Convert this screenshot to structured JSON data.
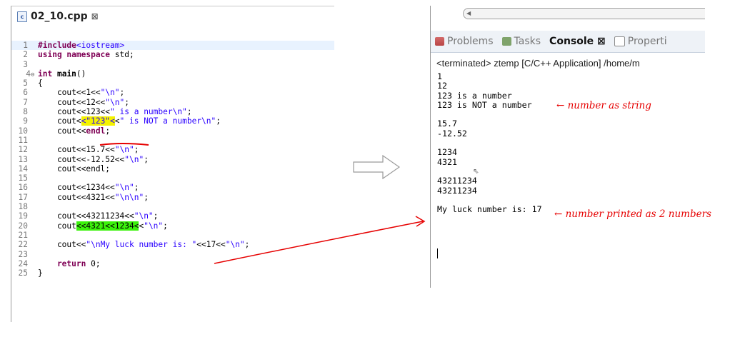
{
  "editor": {
    "tab_icon": "c",
    "tab_title": "02_10.cpp",
    "tab_close": "⊠",
    "fold_marker": "⊖",
    "lines": [
      {
        "n": "1"
      },
      {
        "n": "2"
      },
      {
        "n": "3"
      },
      {
        "n": "4"
      },
      {
        "n": "5"
      },
      {
        "n": "6"
      },
      {
        "n": "7"
      },
      {
        "n": "8"
      },
      {
        "n": "9"
      },
      {
        "n": "10"
      },
      {
        "n": "11"
      },
      {
        "n": "12"
      },
      {
        "n": "13"
      },
      {
        "n": "14"
      },
      {
        "n": "15"
      },
      {
        "n": "16"
      },
      {
        "n": "17"
      },
      {
        "n": "18"
      },
      {
        "n": "19"
      },
      {
        "n": "20"
      },
      {
        "n": "21"
      },
      {
        "n": "22"
      },
      {
        "n": "23"
      },
      {
        "n": "24"
      },
      {
        "n": "25"
      }
    ],
    "code": {
      "l1_kw": "#include",
      "l1_str": "<iostream>",
      "l2_kw": "using namespace",
      "l2_rest": " std;",
      "l4_kw": "int",
      "l4_fn": "main",
      "l4_rest": "()",
      "l5": "{",
      "l6_a": "    cout<<1<<",
      "l6_s": "\"\\n\"",
      "l6_b": ";",
      "l7_a": "    cout<<12<<",
      "l7_s": "\"\\n\"",
      "l7_b": ";",
      "l8_a": "    cout<<123<<",
      "l8_s": "\" is a number\\n\"",
      "l8_b": ";",
      "l9_a": "    cout<",
      "l9_hl": "<\"123\"<",
      "l9_b": "<",
      "l9_s": "\" is NOT a number\\n\"",
      "l9_c": ";",
      "l10_a": "    cout<<",
      "l10_kw": "endl",
      "l10_b": ";",
      "l12_a": "    cout<<15.7<<",
      "l12_s": "\"\\n\"",
      "l12_b": ";",
      "l13_a": "    cout<<-12.52<<",
      "l13_s": "\"\\n\"",
      "l13_b": ";",
      "l14_a": "    cout<<endl;",
      "l16_a": "    cout<<1234<<",
      "l16_s": "\"\\n\"",
      "l16_b": ";",
      "l17_a": "    cout<<4321<<",
      "l17_s": "\"\\n\\n\"",
      "l17_b": ";",
      "l19_a": "    cout<<43211234<<",
      "l19_s": "\"\\n\"",
      "l19_b": ";",
      "l20_a": "    cout",
      "l20_hl": "<<4321<<1234<",
      "l20_b": "<",
      "l20_s": "\"\\n\"",
      "l20_c": ";",
      "l22_a": "    cout<<",
      "l22_s": "\"\\nMy luck number is: \"",
      "l22_b": "<<17<<",
      "l22_s2": "\"\\n\"",
      "l22_c": ";",
      "l24_kw": "    return",
      "l24_rest": " 0;",
      "l25": "}"
    }
  },
  "console": {
    "tabs": [
      {
        "label": "Problems"
      },
      {
        "label": "Tasks"
      },
      {
        "label": "Console ⊠"
      },
      {
        "label": "Properti"
      }
    ],
    "terminated": "<terminated> ztemp [C/C++ Application] /home/m",
    "output": [
      "1",
      "12",
      "123 is a number",
      "123 is NOT a number",
      "",
      "15.7",
      "-12.52",
      "",
      "1234",
      "4321",
      "",
      "43211234",
      "43211234",
      "",
      "My luck number is: 17"
    ]
  },
  "annotations": {
    "note1": "← number as string",
    "note2": "← number printed as 2 numbers"
  },
  "colors": {
    "keyword": "#7f0055",
    "string": "#2a00ff",
    "highlight_yellow": "#f4f200",
    "highlight_green": "#3bf20c",
    "annotation": "#e60000"
  }
}
